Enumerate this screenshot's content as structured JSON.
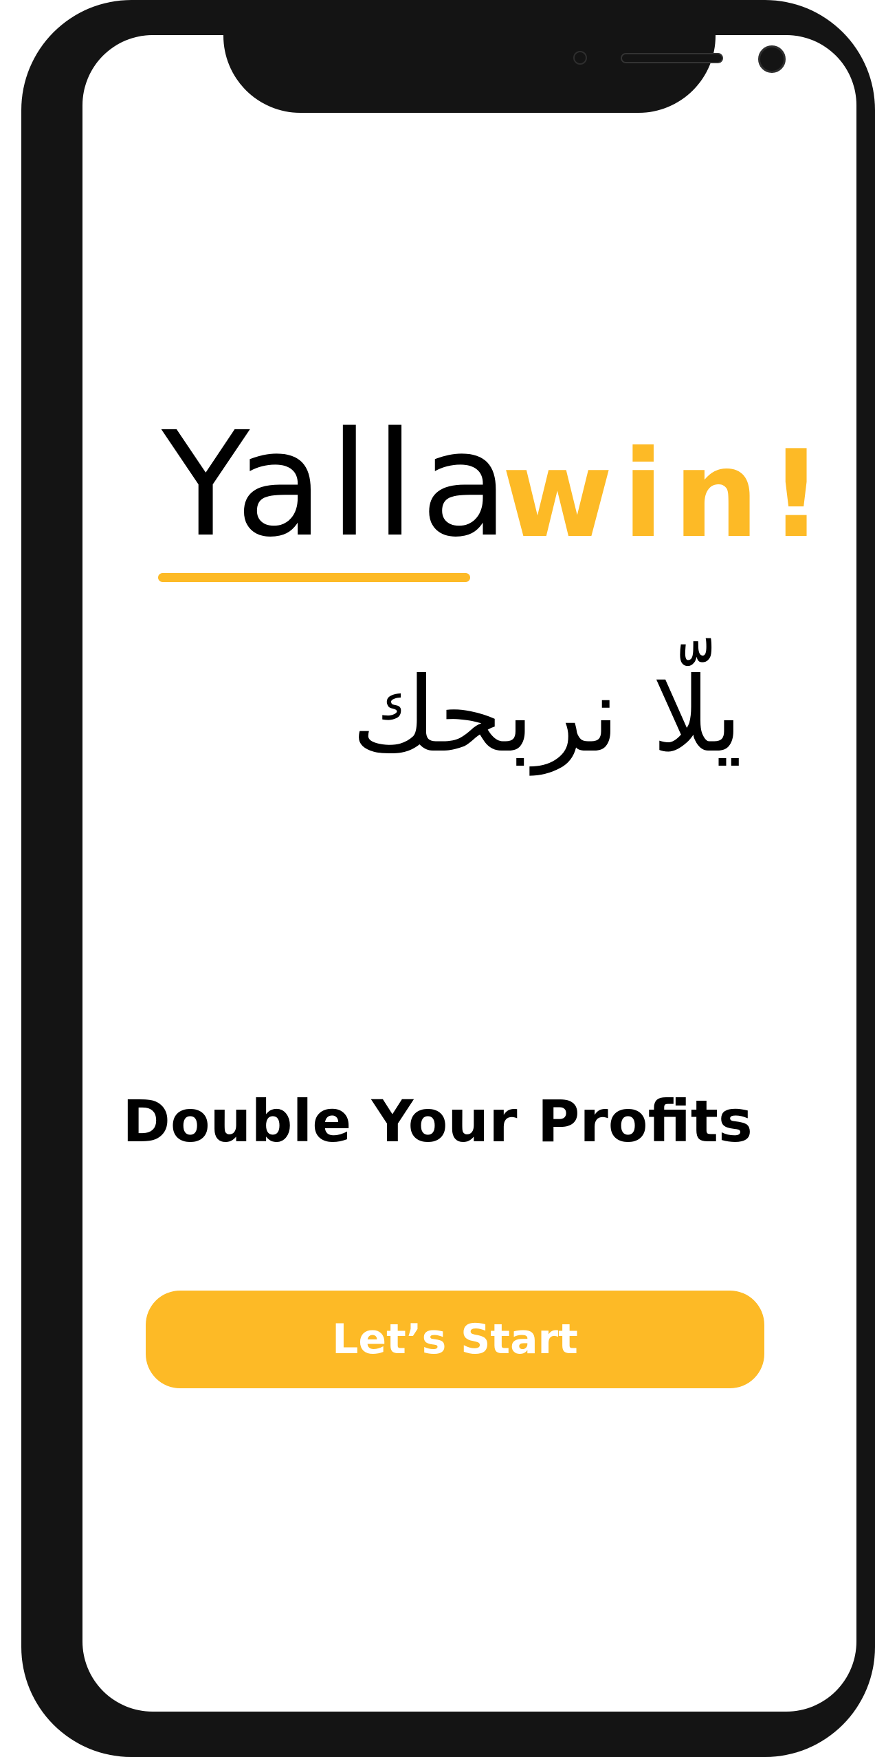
{
  "logo": {
    "word_primary": "Yalla",
    "word_accent": "win!"
  },
  "tagline_arabic": "يلّا نربحك",
  "headline": "Double Your Profits",
  "cta": {
    "label": "Let’s Start"
  },
  "colors": {
    "accent": "#fdba26",
    "text": "#000000",
    "background": "#ffffff",
    "device_frame": "#141414"
  }
}
